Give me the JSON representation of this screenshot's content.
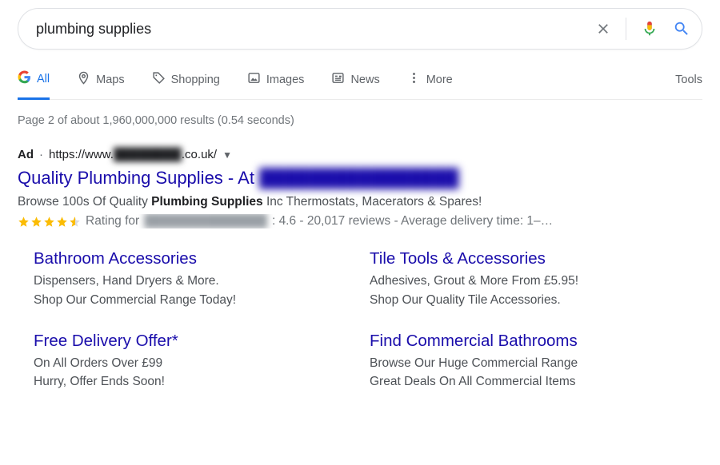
{
  "search": {
    "query": "plumbing supplies"
  },
  "tabs": {
    "all": "All",
    "maps": "Maps",
    "shopping": "Shopping",
    "images": "Images",
    "news": "News",
    "more": "More",
    "tools": "Tools"
  },
  "stats": "Page 2 of about 1,960,000,000 results (0.54 seconds)",
  "ad": {
    "label": "Ad",
    "url_prefix": "https://www.",
    "url_blur": "████████",
    "url_suffix": ".co.uk/",
    "title_prefix": "Quality Plumbing Supplies - At ",
    "title_blur": "████████████████",
    "desc_before": "Browse 100s Of Quality ",
    "desc_bold": "Plumbing Supplies",
    "desc_after": " Inc Thermostats, Macerators & Spares!",
    "rating_for": "Rating for ",
    "rating_blur": "██████████████",
    "rating_tail": ": 4.6 - 20,017 reviews - Average delivery time: 1–…"
  },
  "sitelinks": [
    {
      "title": "Bathroom Accessories",
      "l1": "Dispensers, Hand Dryers & More.",
      "l2": "Shop Our Commercial Range Today!"
    },
    {
      "title": "Tile Tools & Accessories",
      "l1": "Adhesives, Grout & More From £5.95!",
      "l2": "Shop Our Quality Tile Accessories."
    },
    {
      "title": "Free Delivery Offer*",
      "l1": "On All Orders Over £99",
      "l2": "Hurry, Offer Ends Soon!"
    },
    {
      "title": "Find Commercial Bathrooms",
      "l1": "Browse Our Huge Commercial Range",
      "l2": "Great Deals On All Commercial Items"
    }
  ]
}
